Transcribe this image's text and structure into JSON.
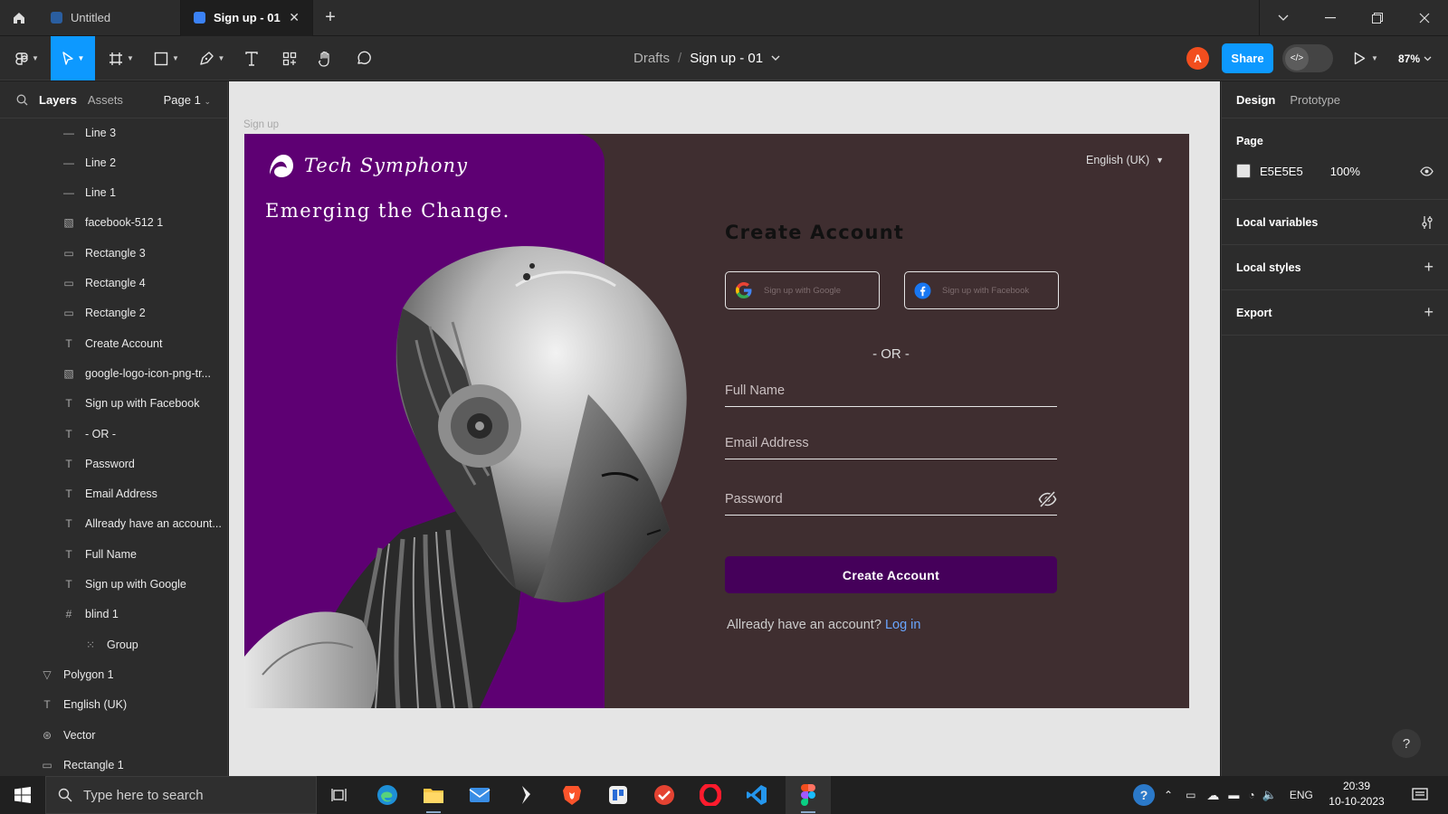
{
  "window": {
    "tabs": [
      {
        "label": "Untitled"
      },
      {
        "label": "Sign up - 01"
      }
    ],
    "new_tab": "+"
  },
  "toolbar": {
    "breadcrumb_root": "Drafts",
    "breadcrumb_sep": "/",
    "file_name": "Sign up - 01",
    "avatar_initial": "A",
    "share_label": "Share",
    "zoom": "87%"
  },
  "left_panel": {
    "tabs": [
      "Layers",
      "Assets"
    ],
    "page_selector": "Page 1",
    "layers": [
      {
        "name": "Line 3",
        "icon": "line-icon"
      },
      {
        "name": "Line 2",
        "icon": "line-icon"
      },
      {
        "name": "Line 1",
        "icon": "line-icon"
      },
      {
        "name": "facebook-512 1",
        "icon": "image-icon"
      },
      {
        "name": "Rectangle 3",
        "icon": "rectangle-icon"
      },
      {
        "name": "Rectangle 4",
        "icon": "rectangle-icon"
      },
      {
        "name": "Rectangle 2",
        "icon": "rectangle-icon"
      },
      {
        "name": "Create Account",
        "icon": "text-icon"
      },
      {
        "name": "google-logo-icon-png-tr...",
        "icon": "image-icon"
      },
      {
        "name": "Sign up with Facebook",
        "icon": "text-icon"
      },
      {
        "name": "- OR -",
        "icon": "text-icon"
      },
      {
        "name": "Password",
        "icon": "text-icon"
      },
      {
        "name": "Email Address",
        "icon": "text-icon"
      },
      {
        "name": "Allready have an account...",
        "icon": "text-icon"
      },
      {
        "name": "Full Name",
        "icon": "text-icon"
      },
      {
        "name": "Sign up with Google",
        "icon": "text-icon"
      },
      {
        "name": "blind 1",
        "icon": "frame-icon"
      },
      {
        "name": "Group",
        "icon": "group-icon"
      },
      {
        "name": "Polygon 1",
        "icon": "polygon-icon"
      },
      {
        "name": "English (UK)",
        "icon": "text-icon"
      },
      {
        "name": "Vector",
        "icon": "vector-icon"
      },
      {
        "name": "Rectangle 1",
        "icon": "rectangle-icon"
      }
    ]
  },
  "canvas": {
    "frame_label": "Sign up",
    "brand": "Tech Symphony",
    "tagline": "Emerging the Change.",
    "language": "English (UK)",
    "form_title": "Create Account",
    "google_button": "Sign up with Google",
    "facebook_button": "Sign up with Facebook",
    "or_divider": "- OR -",
    "fields": {
      "full_name": "Full Name",
      "email": "Email Address",
      "password": "Password"
    },
    "submit_label": "Create Account",
    "already_text": "Allready have an account?",
    "login_link": "Log in",
    "colors": {
      "page_bg": "#E5E5E5",
      "left_panel": "#5E0073",
      "right_panel": "#3F2E30",
      "cta": "#45005A"
    }
  },
  "right_panel": {
    "tabs": [
      "Design",
      "Prototype"
    ],
    "page_section": "Page",
    "page_color": "E5E5E5",
    "page_opacity": "100%",
    "local_variables": "Local variables",
    "local_styles": "Local styles",
    "export": "Export",
    "help": "?"
  },
  "taskbar": {
    "search_placeholder": "Type here to search",
    "language": "ENG",
    "time": "20:39",
    "date": "10-10-2023"
  }
}
